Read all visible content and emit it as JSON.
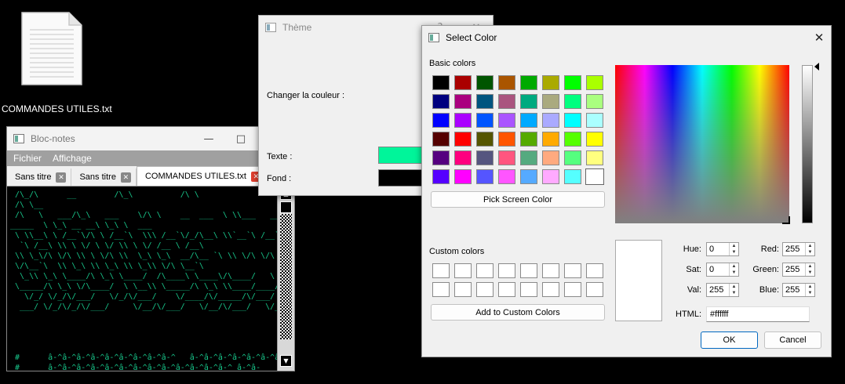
{
  "desktop": {
    "file_icon": {
      "label": "COMMANDES UTILES.txt",
      "icon": "text-file-icon"
    }
  },
  "notepad": {
    "title": "Bloc-notes",
    "menu": [
      "Fichier",
      "Affichage"
    ],
    "tabs": [
      {
        "label": "Sans titre"
      },
      {
        "label": "Sans titre"
      },
      {
        "label": "COMMANDES UTILES.txt"
      }
    ],
    "active_tab": 2,
    "text_color": "#18c58a",
    "content": " /\\_/\\      __        /\\_\\          /\\ \\                  /\\__\n /\\ \\__\n /\\   \\   ___/\\_\\   ___    \\/\\ \\    __  ___  \\ \\\\___   __   ___\n_____  \\ \\_\\ __ __\\ \\_\\ \\  ___\n \\ \\\\__\\ \\ /__`\\/\\ \\ /__`\\  \\\\\\ /__`\\/_/\\__\\ \\\\`__`\\ /__`\\/ _\n  `\\ /__\\ \\\\ \\ \\/ \\ \\/ \\\\ \\ \\/ /__ \\ /__\\\n \\\\ \\_\\/\\ \\/\\ \\\\ \\ \\/\\ \\\\  \\_\\ \\_\\  __/\\__ `\\ \\\\ \\/\\ \\/\\ \\/\\ \\/\\\n \\/\\__`\\  \\\\ \\_\\ \\\\ \\_\\ \\\\ \\_\\\\ \\/\\ \\__`\\\n  \\_\\\\ \\_\\ \\____/\\ \\_\\ \\____/  /\\____\\ \\____\\/\\____/   \\ \\__/\\\n \\_____/\\ \\_\\ \\/\\____/  \\ \\__\\\\ \\_____/\\ \\_\\ \\\\____/____/\n   \\/_/ \\/_/\\/___/   \\/_/\\/___/    \\/____/\\/_____/\\/___/    \\/___/ \\/\n  ___/ \\/_/\\/_/\\/___/     \\/__/\\/___/   \\/__/\\/___/   \\/___/\n\n\n\n\n #      â-^â-^â-^â-^â-^â-^â-^â-^â-^   â-^â-^â-^â-^â-^â-^â-^\n #      â-^â-^â-^â-^â-^â-^â-^â-^â-^â-^â-^â-^â-^_â-^â-\n ^â-^â-^â-^â-^â-^â-^"
  },
  "theme_dialog": {
    "title": "Thème",
    "help_glyph": "?",
    "change_color_label": "Changer la couleur :",
    "text_label": "Texte :",
    "background_label": "Fond :",
    "text_color": "#00f59a",
    "background_color": "#000000"
  },
  "color_dialog": {
    "title": "Select Color",
    "basic_colors_label": "Basic colors",
    "basic_colors": [
      "#000000",
      "#aa0000",
      "#005500",
      "#aa5500",
      "#00aa00",
      "#aaaa00",
      "#00ff00",
      "#aaff00",
      "#00007f",
      "#aa007f",
      "#00557f",
      "#aa557f",
      "#00aa7f",
      "#aaaa7f",
      "#00ff7f",
      "#aaff7f",
      "#0000ff",
      "#aa00ff",
      "#0055ff",
      "#aa55ff",
      "#00aaff",
      "#aaaaff",
      "#00ffff",
      "#aaffff",
      "#550000",
      "#ff0000",
      "#555500",
      "#ff5500",
      "#55aa00",
      "#ffaa00",
      "#55ff00",
      "#ffff00",
      "#55007f",
      "#ff007f",
      "#55557f",
      "#ff557f",
      "#55aa7f",
      "#ffaa7f",
      "#55ff7f",
      "#ffff7f",
      "#5500ff",
      "#ff00ff",
      "#5555ff",
      "#ff55ff",
      "#55aaff",
      "#ffaaff",
      "#55ffff",
      "#ffffff"
    ],
    "selected_basic_index": 47,
    "pick_screen_label": "Pick Screen Color",
    "custom_colors_label": "Custom colors",
    "custom_colors": [
      "#ffffff",
      "#ffffff",
      "#ffffff",
      "#ffffff",
      "#ffffff",
      "#ffffff",
      "#ffffff",
      "#ffffff",
      "#ffffff",
      "#ffffff",
      "#ffffff",
      "#ffffff",
      "#ffffff",
      "#ffffff",
      "#ffffff",
      "#ffffff"
    ],
    "add_custom_label": "Add to Custom Colors",
    "fields": {
      "hue": {
        "label": "Hue:",
        "value": "0"
      },
      "sat": {
        "label": "Sat:",
        "value": "0"
      },
      "val": {
        "label": "Val:",
        "value": "255"
      },
      "red": {
        "label": "Red:",
        "value": "255"
      },
      "green": {
        "label": "Green:",
        "value": "255"
      },
      "blue": {
        "label": "Blue:",
        "value": "255"
      }
    },
    "html_label": "HTML:",
    "html_value": "#ffffff",
    "ok_label": "OK",
    "cancel_label": "Cancel",
    "current_color": "#ffffff"
  }
}
